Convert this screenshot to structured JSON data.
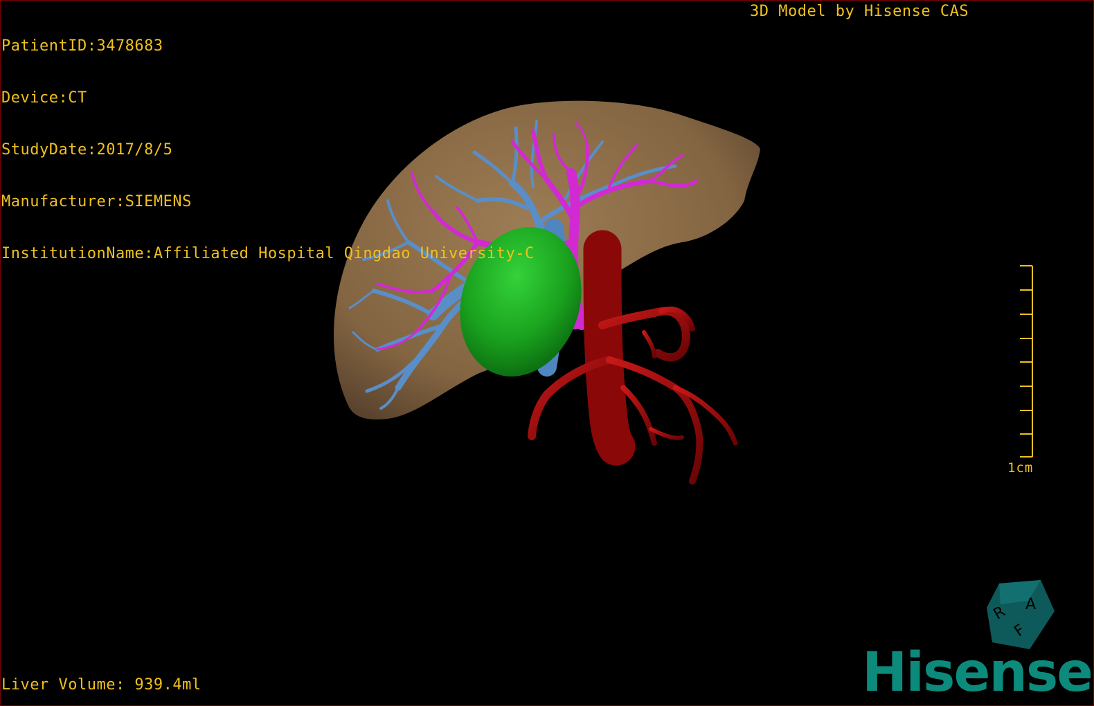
{
  "header": {
    "patient_id": "PatientID:3478683",
    "device": "Device:CT",
    "study_date": "StudyDate:2017/8/5",
    "manufacturer": "Manufacturer:SIEMENS",
    "institution": "InstitutionName:Affiliated Hospital Qingdao University-C",
    "credit": "3D Model by Hisense CAS"
  },
  "footer": {
    "liver_volume": "Liver Volume: 939.4ml"
  },
  "scale": {
    "label": "1cm",
    "ticks": 9
  },
  "orientation_cube": {
    "faces": [
      "R",
      "A",
      "F"
    ],
    "color": "#0e5a5a"
  },
  "brand": {
    "logo_text": "Hisense",
    "color": "#0c8a7c"
  },
  "colors": {
    "overlay_text": "#f0c020",
    "liver": "#8a6a45",
    "tumor": "#1faa22",
    "portal_vein": "#5a8ec8",
    "hepatic_vein": "#d22ad2",
    "artery": "#a80c0c",
    "background": "#000000"
  },
  "structures": [
    "liver",
    "tumor",
    "portal-vein",
    "hepatic-vein",
    "artery"
  ]
}
